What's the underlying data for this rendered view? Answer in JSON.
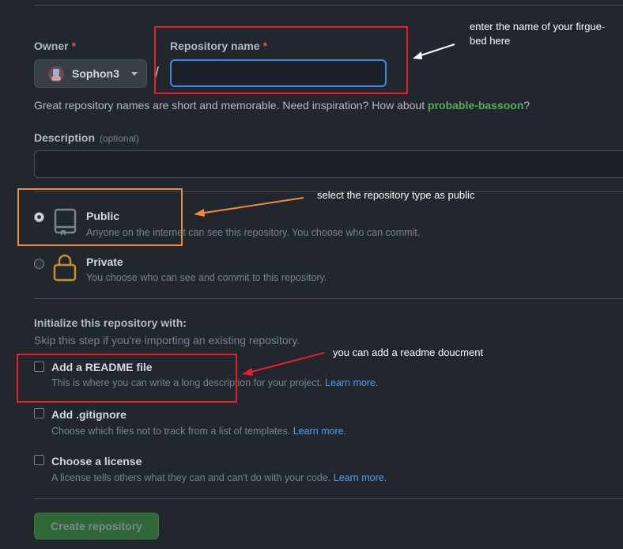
{
  "owner": {
    "label": "Owner",
    "required": "*",
    "value": "Sophon3"
  },
  "repo_name": {
    "label": "Repository name",
    "required": "*",
    "value": "",
    "separator": "/"
  },
  "hint": {
    "prefix": "Great repository names are short and memorable. Need inspiration? How about ",
    "suggestion": "probable-bassoon",
    "suffix": "?"
  },
  "description": {
    "label": "Description",
    "optional": "(optional)",
    "value": ""
  },
  "visibility": {
    "public": {
      "title": "Public",
      "desc": "Anyone on the internet can see this repository. You choose who can commit.",
      "selected": true
    },
    "private": {
      "title": "Private",
      "desc": "You choose who can see and commit to this repository.",
      "selected": false
    }
  },
  "init": {
    "heading": "Initialize this repository with:",
    "subheading": "Skip this step if you're importing an existing repository.",
    "readme": {
      "title": "Add a README file",
      "desc": "This is where you can write a long description for your project. ",
      "link": "Learn more."
    },
    "gitignore": {
      "title": "Add .gitignore",
      "desc": "Choose which files not to track from a list of templates. ",
      "link": "Learn more."
    },
    "license": {
      "title": "Choose a license",
      "desc": "A license tells others what they can and can't do with your code. ",
      "link": "Learn more."
    }
  },
  "create_button": "Create repository",
  "annotations": {
    "name": "enter the name of your firgue-bed here",
    "type": "select the repository type as public",
    "readme": "you can add a readme doucment"
  },
  "colors": {
    "accent_green": "#57ab5a",
    "annotation_red": "#e5202a",
    "annotation_orange": "#f0883e",
    "link_blue": "#539bf5"
  }
}
